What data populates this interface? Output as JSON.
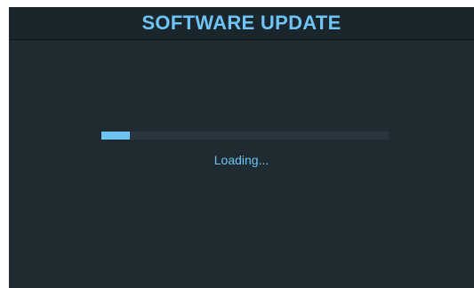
{
  "header": {
    "title": "SOFTWARE UPDATE"
  },
  "progress": {
    "value": 0.1,
    "status_text": "Loading..."
  },
  "colors": {
    "background": "#1f2a31",
    "header_background": "#1b252c",
    "accent": "#6ec4f4",
    "track": "#2a363e",
    "page": "#ffffff"
  }
}
